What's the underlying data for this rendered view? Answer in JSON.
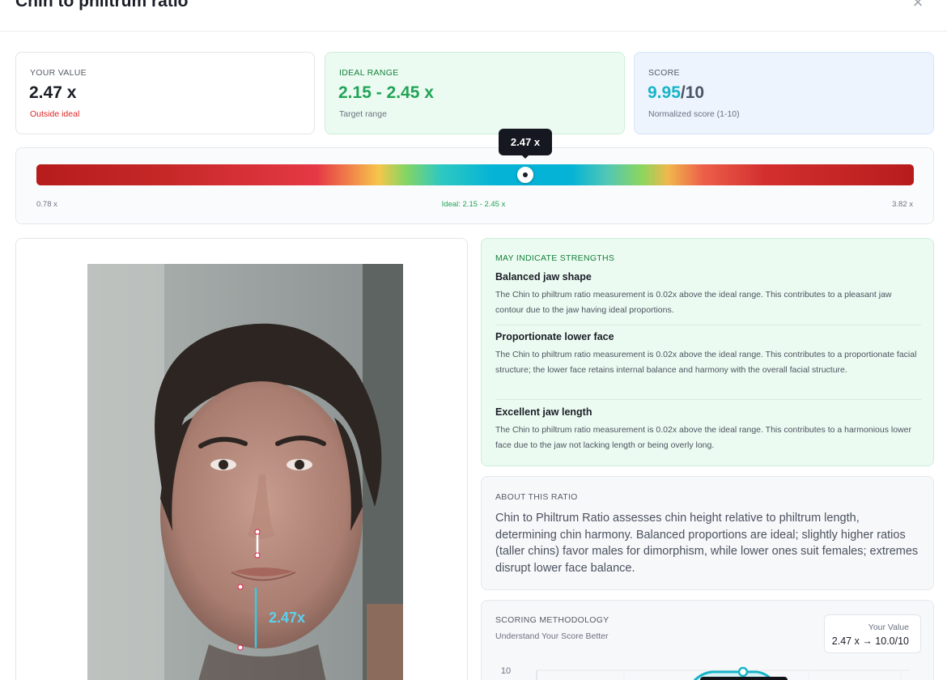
{
  "header": {
    "title": "Chin to philtrum ratio",
    "close_label": "×"
  },
  "cards": {
    "value": {
      "label": "YOUR VALUE",
      "value": "2.47 x",
      "status": "Outside ideal"
    },
    "range": {
      "label": "IDEAL RANGE",
      "value": "2.15 - 2.45 x",
      "note": "Target range"
    },
    "score": {
      "label": "SCORE",
      "value": "9.95",
      "max": "/10",
      "note": "Normalized score (1-10)"
    }
  },
  "meter": {
    "min_label": "0.78 x",
    "max_label": "3.82 x",
    "ideal_label": "Ideal: 2.15 - 2.45 x",
    "tooltip": "2.47 x",
    "value": 2.47,
    "min": 0.78,
    "max": 3.82
  },
  "photo": {
    "measurement_label": "2.47x"
  },
  "strengths": {
    "heading": "MAY INDICATE STRENGTHS",
    "items": [
      {
        "title": "Balanced jaw shape",
        "desc": "The Chin to philtrum ratio measurement is 0.02x above the ideal range. This contributes to a pleasant jaw contour due to the jaw having ideal proportions."
      },
      {
        "title": "Proportionate lower face",
        "desc": "The Chin to philtrum ratio measurement is 0.02x above the ideal range. This contributes to a proportionate facial structure; the lower face retains internal balance and harmony with the overall facial structure."
      },
      {
        "title": "Excellent jaw length",
        "desc": "The Chin to philtrum ratio measurement is 0.02x above the ideal range. This contributes to a harmonious lower face due to the jaw not lacking length or being overly long."
      }
    ]
  },
  "about": {
    "heading": "ABOUT THIS RATIO",
    "text": "Chin to Philtrum Ratio assesses chin height relative to philtrum length, determining chin harmony. Balanced proportions are ideal; slightly higher ratios (taller chins) favor males for dimorphism, while lower ones suit females; extremes disrupt lower face balance."
  },
  "methodology": {
    "heading": "SCORING METHODOLOGY",
    "subheading": "Understand Your Score Better",
    "your_value_label": "Your Value",
    "your_value": "2.47 x → 10.0/10",
    "y_tick_top": "10"
  },
  "colors": {
    "accent_teal": "#18b4c8",
    "ideal_green": "#22a357",
    "warning_red": "#dc2626",
    "strength_bg": "#ecfbf1",
    "score_bg": "#edf4fe"
  }
}
